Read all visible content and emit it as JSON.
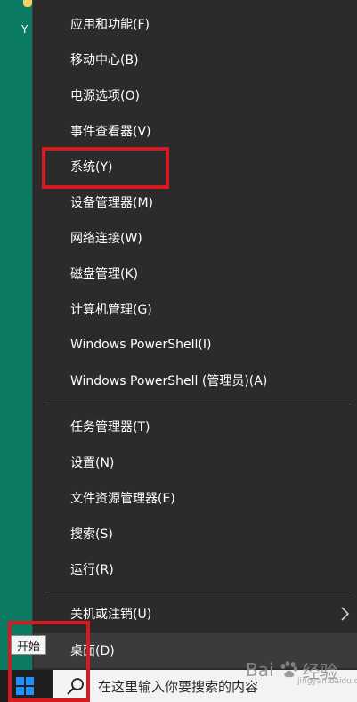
{
  "desktop": {
    "icon_letter": "Y"
  },
  "menu": {
    "group1": [
      "应用和功能(F)",
      "移动中心(B)",
      "电源选项(O)",
      "事件查看器(V)",
      "系统(Y)",
      "设备管理器(M)",
      "网络连接(W)",
      "磁盘管理(K)",
      "计算机管理(G)",
      "Windows PowerShell(I)",
      "Windows PowerShell (管理员)(A)"
    ],
    "group2": [
      "任务管理器(T)",
      "设置(N)",
      "文件资源管理器(E)",
      "搜索(S)",
      "运行(R)"
    ],
    "group3": [
      "关机或注销(U)",
      "桌面(D)"
    ]
  },
  "tooltip": {
    "label": "开始"
  },
  "taskbar": {
    "search_placeholder": "在这里输入你要搜索的内容"
  },
  "watermark": {
    "text": "Bai",
    "text2": "经验",
    "sub": "jingyan.baidu.com"
  },
  "colors": {
    "menu_bg": "#2b2b2b",
    "highlight": "#d71920",
    "desktop": "#0b7a63"
  }
}
